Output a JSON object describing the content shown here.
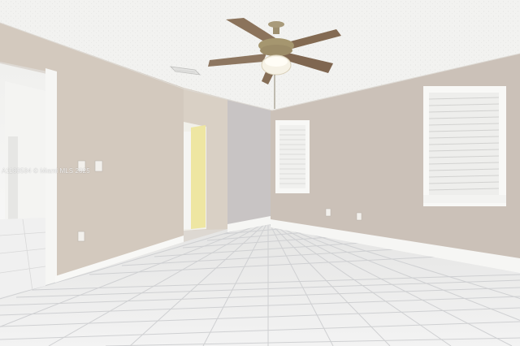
{
  "scene": {
    "description_free": true,
    "watermark": "A1183584 © Miami MLS 2025"
  },
  "colors": {
    "ceiling": "#f3f3f1",
    "wall_left": "#d2c8bd",
    "wall_back": "#cfc6bc",
    "wall_right": "#c9bfb6",
    "floor": "#eeeeee",
    "grout": "#cfd0d1",
    "baseboard": "#f7f7f5",
    "fan_blade": "#8a7058",
    "fan_metal": "#9a8a6a",
    "hall_wall": "#efe8a8"
  }
}
